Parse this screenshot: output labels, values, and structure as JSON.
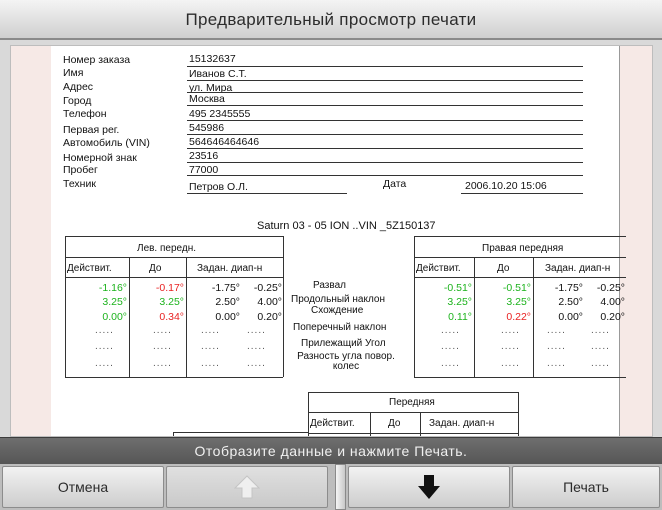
{
  "window": {
    "title": "Предварительный просмотр печати"
  },
  "form": {
    "rows": [
      {
        "label": "Номер заказа",
        "value": "15132637"
      },
      {
        "label": "Имя",
        "value": "Иванов С.Т."
      },
      {
        "label": "Адрес",
        "value": "ул. Мира"
      },
      {
        "label": "Город",
        "value": "Москва"
      },
      {
        "label": "Телефон",
        "value": "495 2345555"
      },
      {
        "label": "Первая рег.",
        "value": "545986"
      },
      {
        "label": "Автомобиль (VIN)",
        "value": "564646464646"
      },
      {
        "label": "Номерной знак",
        "value": "23516"
      },
      {
        "label": "Пробег",
        "value": "77000"
      },
      {
        "label": "Техник",
        "value": "Петров О.Л."
      }
    ],
    "date_label": "Дата",
    "date_value": "2006.10.20 15:06"
  },
  "vehicle_title": "Saturn 03 - 05 ION ..VIN _5Z150137",
  "table": {
    "left_title": "Лев. передн.",
    "right_title": "Правая передняя",
    "col_headers": [
      "Действит.",
      "До",
      "Задан. диап-н"
    ],
    "params": [
      "Развал",
      "Продольный наклон",
      "Схождение",
      "Поперечный наклон",
      "Прилежащий Угол",
      "Разность угла повор. колес"
    ],
    "left": {
      "actual": [
        "-1.16°",
        "3.25°",
        "0.00°"
      ],
      "before": [
        "-0.17°",
        "3.25°",
        "0.34°"
      ],
      "range_min": [
        "-1.75°",
        "2.50°",
        "0.00°"
      ],
      "range_max": [
        "-0.25°",
        "4.00°",
        "0.20°"
      ]
    },
    "right": {
      "actual": [
        "-0.51°",
        "3.25°",
        "0.11°"
      ],
      "before": [
        "-0.51°",
        "3.25°",
        "0.22°"
      ],
      "range_min": [
        "-1.75°",
        "2.50°",
        "0.00°"
      ],
      "range_max": [
        "-0.25°",
        "4.00°",
        "0.20°"
      ]
    },
    "dots": "....."
  },
  "front_table": {
    "title": "Передняя",
    "col_headers": [
      "Действит.",
      "До",
      "Задан. диап-н"
    ]
  },
  "status": {
    "message": "Отобразите данные и нажмите Печать."
  },
  "buttons": {
    "cancel": "Отмена",
    "print": "Печать"
  },
  "colors": {
    "good": "#1db31d",
    "bad": "#e82222"
  }
}
